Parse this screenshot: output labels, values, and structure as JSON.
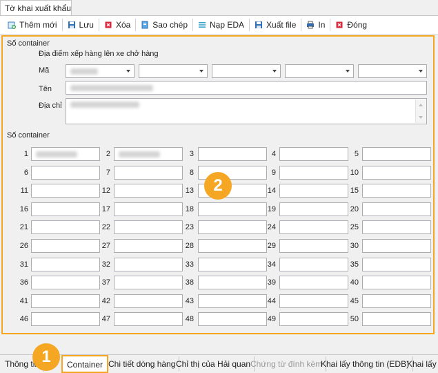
{
  "document_tab": {
    "label": "Tờ khai xuất khẩu"
  },
  "toolbar": {
    "items": [
      {
        "label": "Thêm mới",
        "icon": "add-icon",
        "color": "#2e9e4a"
      },
      {
        "label": "Lưu",
        "icon": "save-icon",
        "color": "#2f6eb5"
      },
      {
        "label": "Xóa",
        "icon": "delete-icon",
        "color": "#d9263a"
      },
      {
        "label": "Sao chép",
        "icon": "copy-icon",
        "color": "#2f8bd6"
      },
      {
        "label": "Nạp EDA",
        "icon": "load-icon",
        "color": "#3aa3c8"
      },
      {
        "label": "Xuất file",
        "icon": "export-icon",
        "color": "#2f6eb5"
      },
      {
        "label": "In",
        "icon": "print-icon",
        "color": "#2f6eb5"
      },
      {
        "label": "Đóng",
        "icon": "close-icon",
        "color": "#d9263a"
      }
    ]
  },
  "section_top": {
    "legend": "Số container",
    "subtitle": "Địa điểm xếp hàng lên xe chở hàng",
    "ma_label": "Mã",
    "ten_label": "Tên",
    "diachi_label": "Địa chỉ"
  },
  "section_containers": {
    "legend": "Số container",
    "numbers": [
      "1",
      "2",
      "3",
      "4",
      "5",
      "6",
      "7",
      "8",
      "9",
      "10",
      "11",
      "12",
      "13",
      "14",
      "15",
      "16",
      "17",
      "18",
      "19",
      "20",
      "21",
      "22",
      "23",
      "24",
      "25",
      "26",
      "27",
      "28",
      "29",
      "30",
      "31",
      "32",
      "33",
      "34",
      "35",
      "36",
      "37",
      "38",
      "39",
      "40",
      "41",
      "42",
      "43",
      "44",
      "45",
      "46",
      "47",
      "48",
      "49",
      "50"
    ]
  },
  "callouts": {
    "one": "1",
    "two": "2"
  },
  "bottom_tabs": [
    {
      "label": "Thông tin",
      "state": "normal"
    },
    {
      "label": "Container",
      "state": "active"
    },
    {
      "label": "Chi tiết dòng hàng",
      "state": "normal"
    },
    {
      "label": "Chỉ thị của Hải quan",
      "state": "normal"
    },
    {
      "label": "Chứng từ đính kèm",
      "state": "disabled"
    },
    {
      "label": "Khai lấy thông tin (EDB)",
      "state": "normal"
    },
    {
      "label": "Khai lấy",
      "state": "normal"
    }
  ],
  "colors": {
    "highlight": "#f5a623"
  }
}
